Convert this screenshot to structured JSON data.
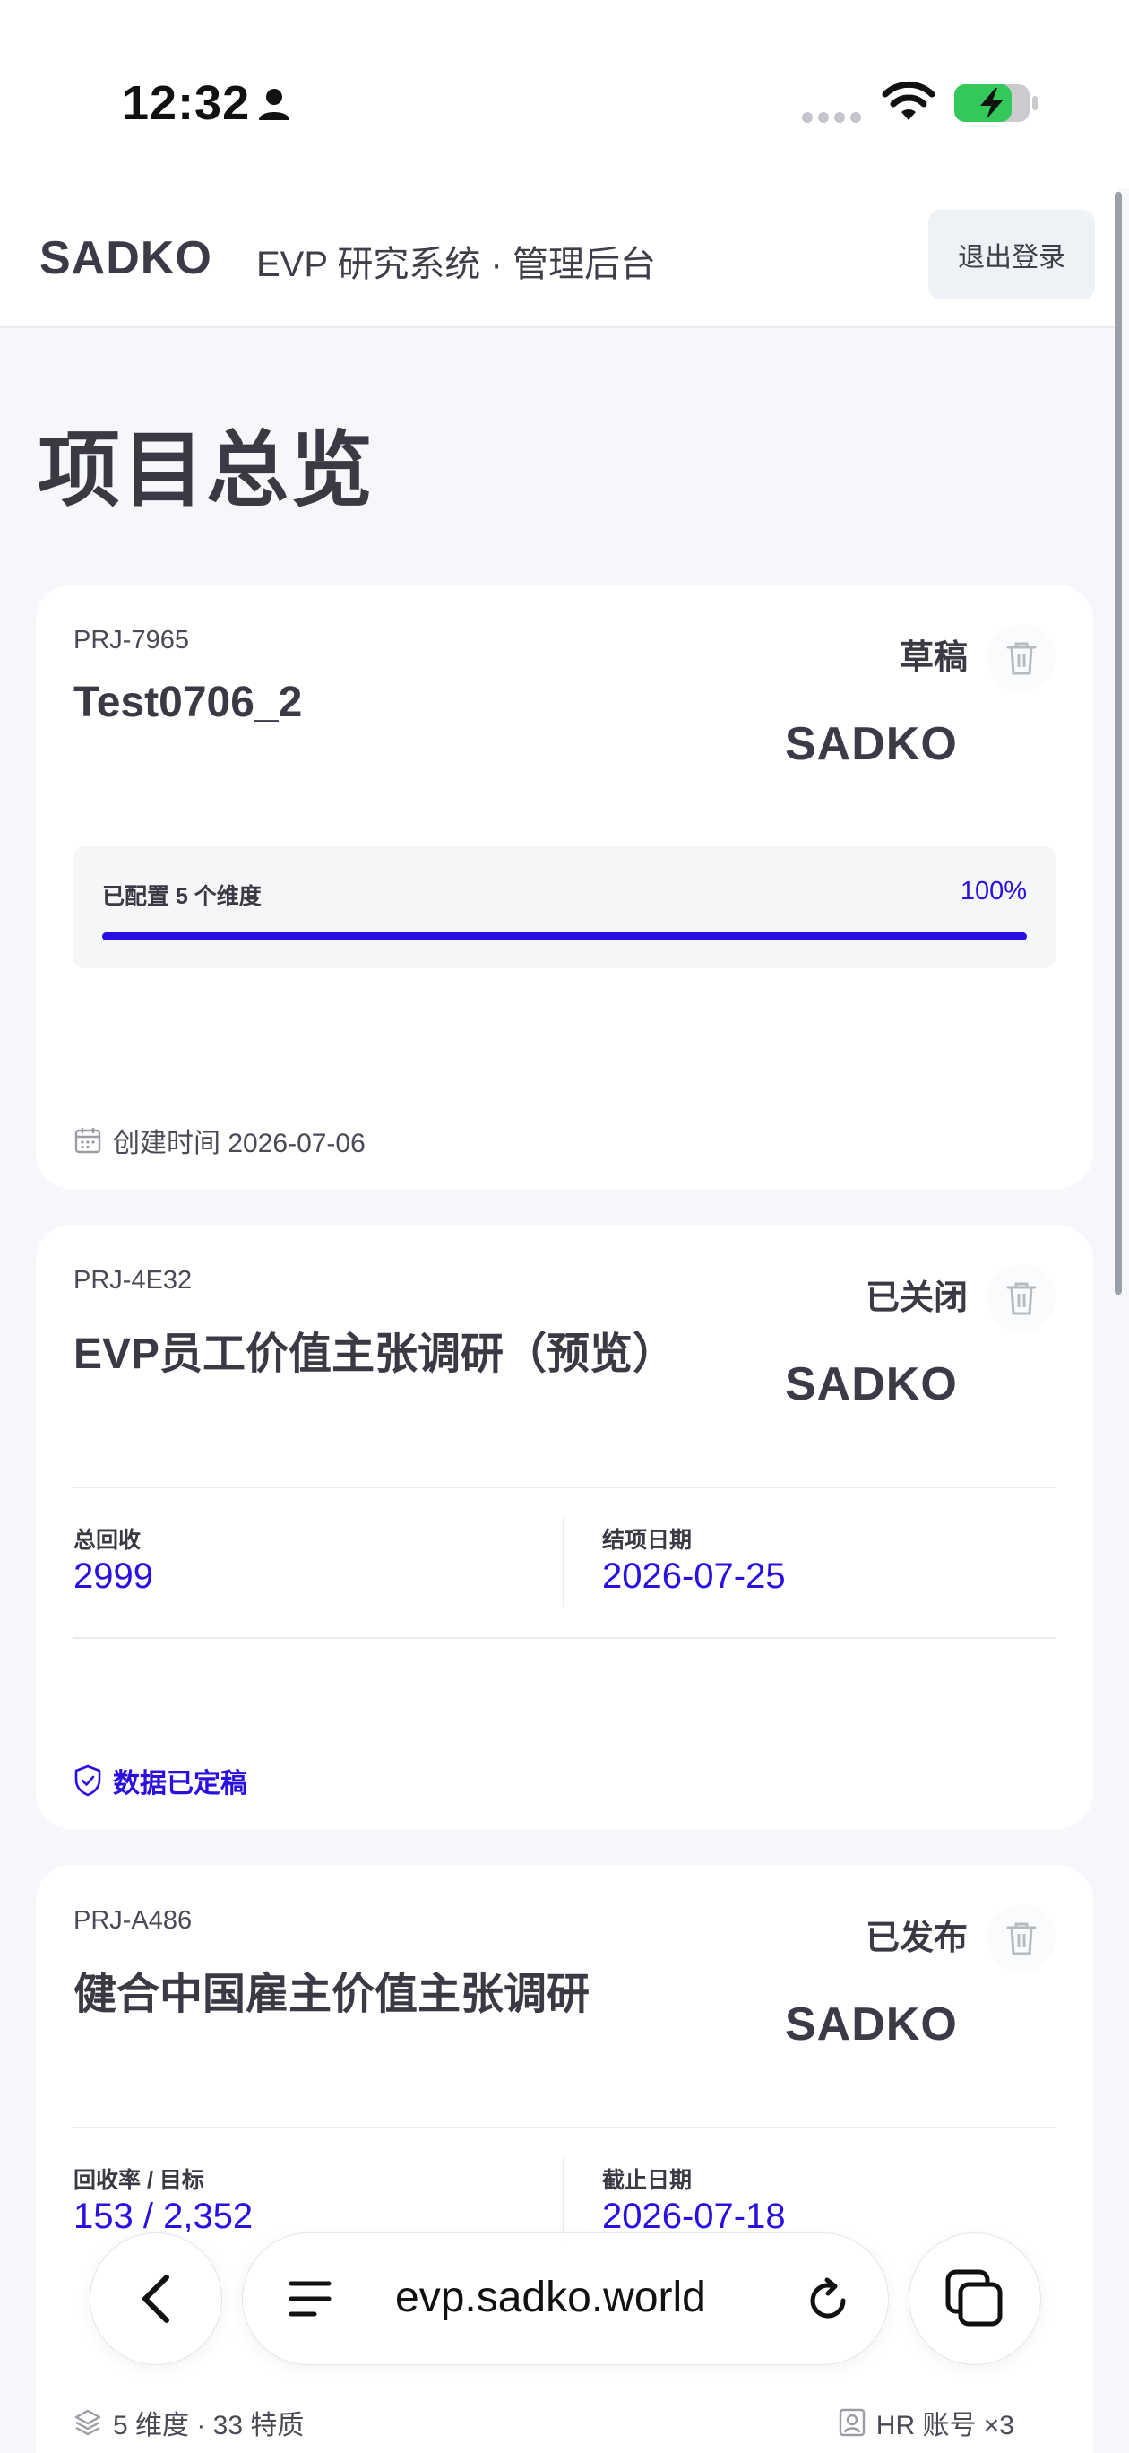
{
  "status_bar": {
    "time": "12:32"
  },
  "header": {
    "logo": "SADKO",
    "title": "EVP 研究系统 · 管理后台",
    "logout_label": "退出登录"
  },
  "page": {
    "title": "项目总览"
  },
  "projects": [
    {
      "id": "PRJ-7965",
      "name": "Test0706_2",
      "status": "草稿",
      "logo": "SADKO",
      "progress_label": "已配置 5 个维度",
      "progress_value": "100%",
      "progress_fraction": 1.0,
      "created": "创建时间 2026-07-06"
    },
    {
      "id": "PRJ-4E32",
      "name": "EVP员工价值主张调研（预览）",
      "status": "已关闭",
      "logo": "SADKO",
      "stat1_label": "总回收",
      "stat1_value": "2999",
      "stat2_label": "结项日期",
      "stat2_value": "2026-07-25",
      "finalized": "数据已定稿"
    },
    {
      "id": "PRJ-A486",
      "name": "健合中国雇主价值主张调研",
      "status": "已发布",
      "logo": "SADKO",
      "stat1_label": "回收率 / 目标",
      "stat1_value": "153 / 2,352",
      "stat2_label": "截止日期",
      "stat2_value": "2026-07-18",
      "footer_left": "5 维度 · 33 特质",
      "footer_right": "HR 账号 ×3"
    }
  ],
  "browser": {
    "url": "evp.sadko.world"
  }
}
